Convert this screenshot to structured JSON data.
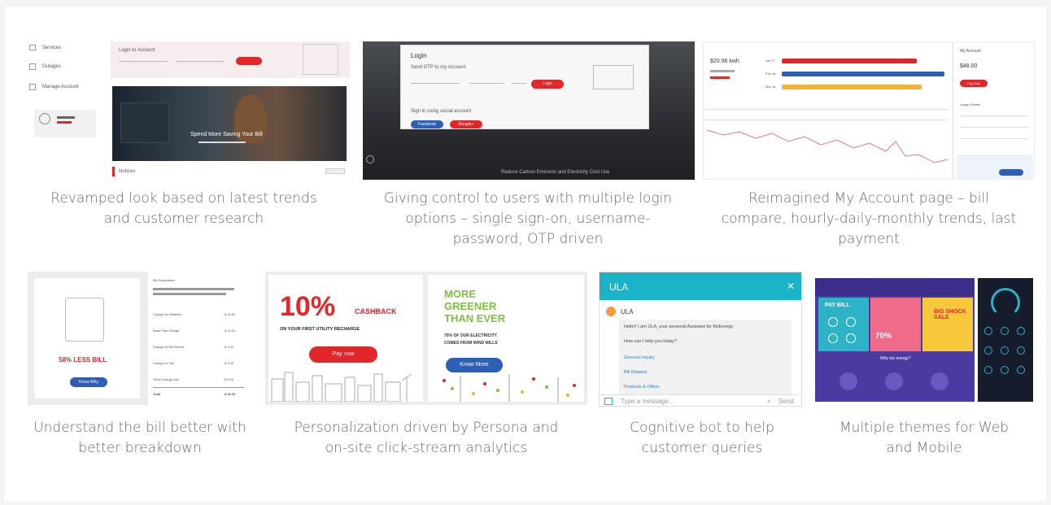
{
  "captions": {
    "c1": "Revamped look based on latest trends and customer research",
    "c2": "Giving control to users with multiple login options – single sign-on, username-password, OTP driven",
    "c3": "Reimagined My Account page – bill compare, hourly-daily-monthly trends, last payment",
    "c4": "Understand the bill better with better breakdown",
    "c5": "Personalization driven by Persona and on-site click-stream analytics",
    "c6": "Cognitive bot to help customer queries",
    "c7": "Multiple themes for Web and Mobile"
  },
  "home": {
    "hero_text": "Spend More Saving Your Bill",
    "login_label": "Login",
    "menu_items": [
      "Services",
      "Outages",
      "Manage Account"
    ]
  },
  "login": {
    "title": "Login",
    "button": "Login",
    "sso_button_1": "Facebook",
    "sso_button_2": "Google+",
    "footer": "Reduce Carbon Emission and Electricity Cost Use"
  },
  "account": {
    "amount": "$20.96 kwh",
    "pay_button": "Pay Now",
    "bars": [
      "Jan 17",
      "Feb 18",
      "Mar 18"
    ]
  },
  "bill": {
    "title": "58% LESS BILL",
    "button": "Know Why",
    "rows": [
      {
        "label": "Charge for Weather",
        "value": "$ 18.00"
      },
      {
        "label": "Base Plan Charge",
        "value": "$ 12.00"
      },
      {
        "label": "Charge for Bill Period",
        "value": "$ 2.00"
      },
      {
        "label": "Charge for Tax",
        "value": "$ 3.00"
      },
      {
        "label": "Other Energy Use",
        "value": "$ 5.00"
      },
      {
        "label": "Total",
        "value": "$ 40.00"
      }
    ]
  },
  "promo": {
    "big": "10%",
    "cashback": "CASHBACK",
    "sub": "ON YOUR FIRST UTILITY RECHARGE",
    "button": "Pay now"
  },
  "green": {
    "line1": "MORE",
    "line2": "GREENER",
    "line3": "THAN EVER",
    "sub1": "70% OF OUR ELECTRICITY",
    "sub2": "COMES FROM WIND MILLS",
    "button": "Know More"
  },
  "bot": {
    "title": "ULA",
    "sender": "ULA",
    "msg1": "Hello!! I am ULA, your personal Assistant for MyEnergy",
    "msg2": "How can I help you today?",
    "opt1": "General Inquiry",
    "opt2": "Bill Related",
    "opt3": "Products & Offers",
    "placeholder": "Type a message...",
    "send": "Send"
  },
  "themes": {
    "tile1": "PAY BILL",
    "tile2": "70%",
    "tile3": "BIG SHOCK SALE",
    "banner": "Why my energy?"
  },
  "colors": {
    "red": "#e3262a",
    "blue": "#2d5fb5",
    "teal": "#1bb3c8",
    "green": "#7cc242",
    "purple": "#5b3fa8"
  }
}
